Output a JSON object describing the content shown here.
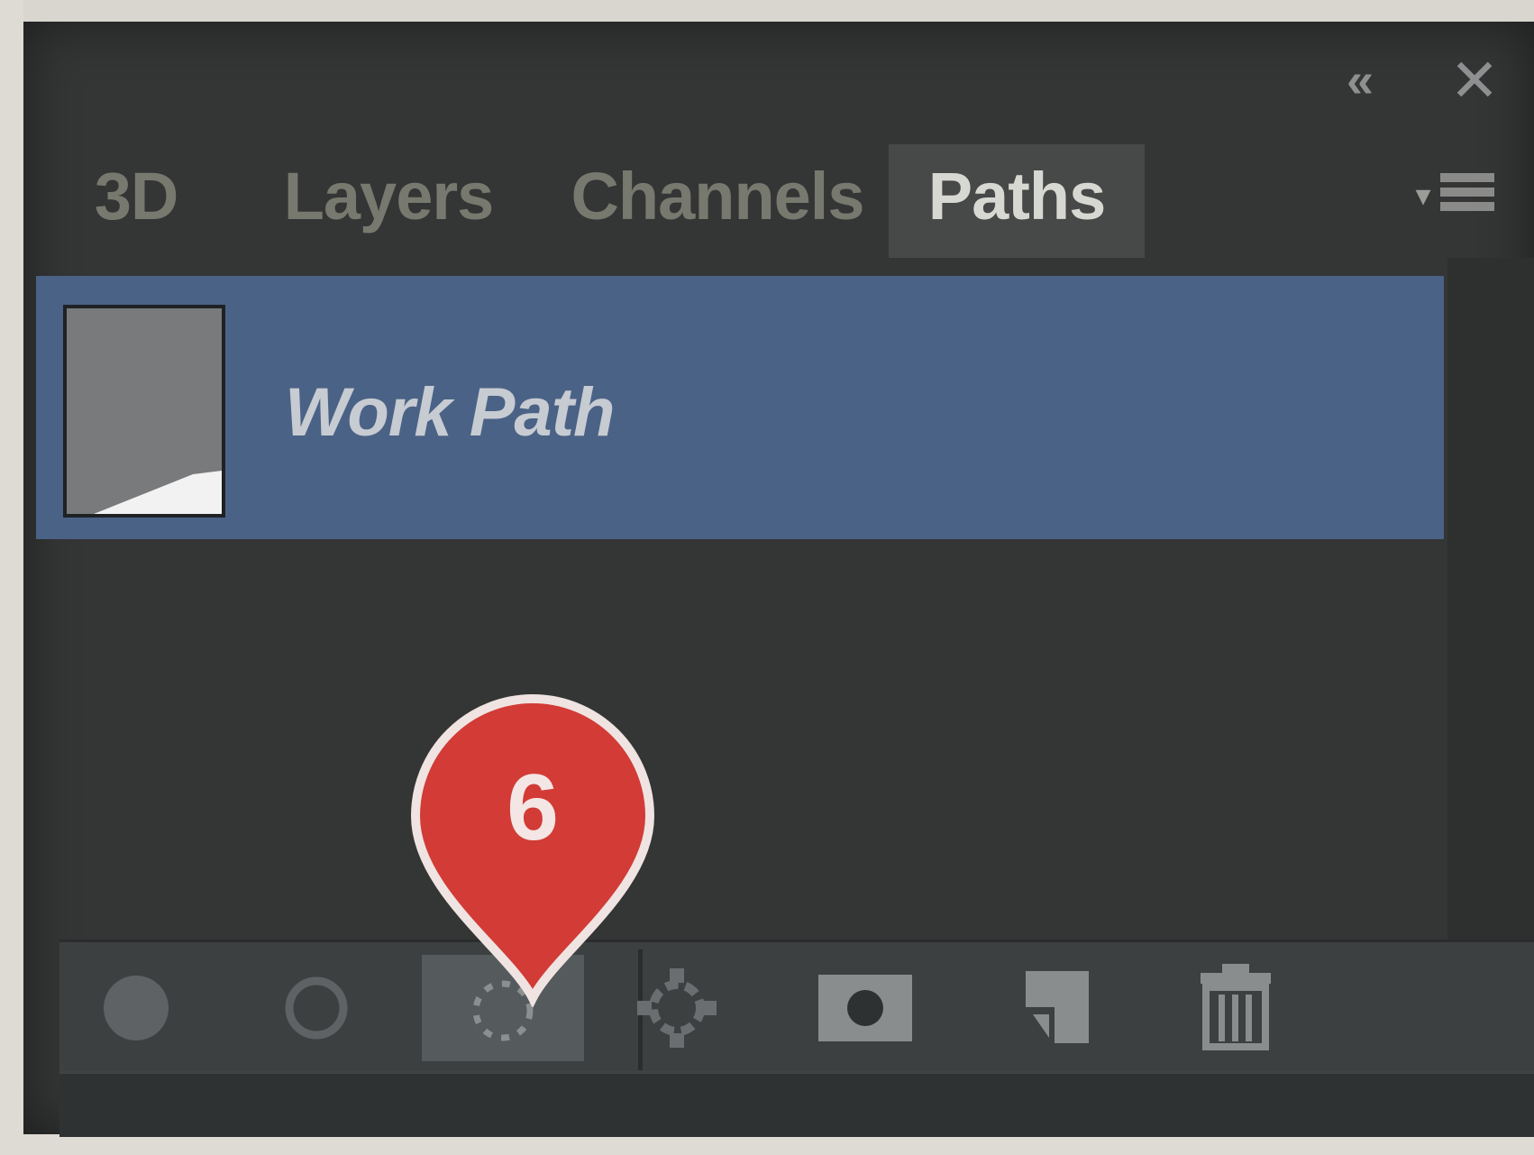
{
  "panel": {
    "tabs": [
      {
        "label": "3D",
        "active": false
      },
      {
        "label": "Layers",
        "active": false
      },
      {
        "label": "Channels",
        "active": false
      },
      {
        "label": "Paths",
        "active": true
      }
    ],
    "window_controls": {
      "collapse": "double-chevron-left-icon",
      "close": "close-icon",
      "menu": "panel-menu-icon"
    }
  },
  "paths": [
    {
      "name": "Work Path",
      "selected": true
    }
  ],
  "marker": {
    "number": "6",
    "color": "#d23b36"
  },
  "toolbar": {
    "buttons": [
      {
        "icon": "fill-path-icon",
        "selected": false
      },
      {
        "icon": "stroke-path-icon",
        "selected": false
      },
      {
        "icon": "load-path-as-selection-icon",
        "selected": true
      },
      {
        "icon": "make-work-path-icon",
        "selected": false
      },
      {
        "icon": "add-mask-icon",
        "selected": false
      },
      {
        "icon": "new-path-icon",
        "selected": false
      },
      {
        "icon": "trash-icon",
        "selected": false
      }
    ]
  },
  "colors": {
    "panel_bg": "#343535",
    "selected_row": "#4a6285",
    "active_tab": "#474948",
    "marker": "#d23b36"
  }
}
